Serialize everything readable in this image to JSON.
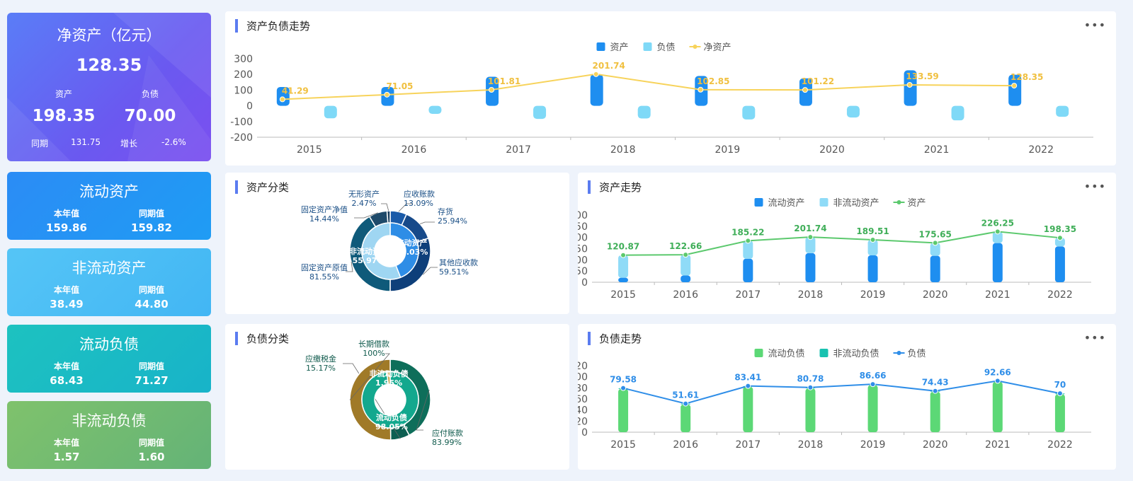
{
  "net_asset_card": {
    "title": "净资产（亿元）",
    "value": "128.35",
    "asset_label": "资产",
    "liability_label": "负债",
    "asset_value": "198.35",
    "liability_value": "70.00",
    "yoy_label": "同期",
    "yoy_value": "131.75",
    "growth_label": "增长",
    "growth_value": "-2.6%"
  },
  "metric_cards": [
    {
      "title": "流动资产",
      "cur_label": "本年值",
      "prev_label": "同期值",
      "cur": "159.86",
      "prev": "159.82"
    },
    {
      "title": "非流动资产",
      "cur_label": "本年值",
      "prev_label": "同期值",
      "cur": "38.49",
      "prev": "44.80"
    },
    {
      "title": "流动负债",
      "cur_label": "本年值",
      "prev_label": "同期值",
      "cur": "68.43",
      "prev": "71.27"
    },
    {
      "title": "非流动负债",
      "cur_label": "本年值",
      "prev_label": "同期值",
      "cur": "1.57",
      "prev": "1.60"
    }
  ],
  "panels": {
    "trend": {
      "title": "资产负债走势",
      "more": "•••"
    },
    "asset_class": {
      "title": "资产分类"
    },
    "asset_trend": {
      "title": "资产走势",
      "more": "•••"
    },
    "liab_class": {
      "title": "负债分类"
    },
    "liab_trend": {
      "title": "负债走势",
      "more": "•••"
    }
  },
  "colors": {
    "asset": "#1e8ef0",
    "liability": "#7fd9f7",
    "net": "#f7d35b",
    "current_asset": "#1e8ef0",
    "noncurrent_asset": "#8fdbf7",
    "asset_line": "#5cc96e",
    "current_liab": "#5cd876",
    "noncurrent_liab": "#19c2b0",
    "liab_line": "#2f8ee8",
    "accent": "#5b7cf0"
  },
  "chart_data": [
    {
      "id": "trend",
      "type": "bar",
      "x": [
        "2015",
        "2016",
        "2017",
        "2018",
        "2019",
        "2020",
        "2021",
        "2022"
      ],
      "ylim": [
        -200,
        300
      ],
      "yticks": [
        300,
        200,
        100,
        0,
        -100,
        -200
      ],
      "series": [
        {
          "name": "资产",
          "type": "bar",
          "values": [
            120,
            120,
            185,
            200,
            190,
            175,
            226,
            198
          ]
        },
        {
          "name": "负债",
          "type": "bar",
          "values": [
            -79.58,
            -51.61,
            -83.41,
            -80.78,
            -86.66,
            -74.43,
            -92.66,
            -70
          ]
        },
        {
          "name": "净资产",
          "type": "line",
          "values": [
            41.29,
            71.05,
            101.81,
            201.74,
            102.85,
            101.22,
            133.59,
            128.35
          ],
          "labels": [
            "41.29",
            "71.05",
            "101.81",
            "201.74",
            "102.85",
            "101.22",
            "133.59",
            "128.35"
          ]
        }
      ]
    },
    {
      "id": "asset_class",
      "type": "pie",
      "inner": [
        {
          "name": "流动资产",
          "value": 44.03,
          "label": "流动资产\n44.03%"
        },
        {
          "name": "非流动资产",
          "value": 55.97,
          "label": "非流动资产\n55.97%"
        }
      ],
      "outer": [
        {
          "name": "应收账款",
          "value": 13.09,
          "label": "13.09%"
        },
        {
          "name": "存货",
          "value": 25.94,
          "label": "25.94%"
        },
        {
          "name": "其他应收款",
          "value": 59.51,
          "label": "59.51%"
        },
        {
          "name": "固定资产原值",
          "value": 81.55,
          "label": "81.55%"
        },
        {
          "name": "固定资产净值",
          "value": 14.44,
          "label": "14.44%"
        },
        {
          "name": "无形资产",
          "value": 2.47,
          "label": "2.47%"
        }
      ]
    },
    {
      "id": "asset_trend",
      "type": "bar",
      "x": [
        "2015",
        "2016",
        "2017",
        "2018",
        "2019",
        "2020",
        "2021",
        "2022"
      ],
      "ylim": [
        0,
        300
      ],
      "yticks": [
        300,
        250,
        200,
        150,
        100,
        50,
        0
      ],
      "series": [
        {
          "name": "流动资产",
          "type": "bar",
          "stack": "a",
          "values": [
            20,
            30,
            105,
            130,
            120,
            118,
            175,
            160
          ]
        },
        {
          "name": "非流动资产",
          "type": "bar",
          "stack": "a",
          "values": [
            100,
            92,
            80,
            71,
            69,
            57,
            50,
            38
          ]
        },
        {
          "name": "资产",
          "type": "line",
          "values": [
            120.87,
            122.66,
            185.22,
            201.74,
            189.51,
            175.65,
            226.25,
            198.35
          ],
          "labels": [
            "120.87",
            "122.66",
            "185.22",
            "201.74",
            "189.51",
            "175.65",
            "226.25",
            "198.35"
          ]
        }
      ]
    },
    {
      "id": "liab_class",
      "type": "pie",
      "inner": [
        {
          "name": "流动负债",
          "value": 98.05,
          "label": "流动负债\n98.05%"
        },
        {
          "name": "非流动负债",
          "value": 1.95,
          "label": "非流动负债\n1.95%"
        }
      ],
      "outer": [
        {
          "name": "应付账款",
          "value": 83.99,
          "label": "83.99%"
        },
        {
          "name": "应缴税金",
          "value": 15.17,
          "label": "15.17%"
        },
        {
          "name": "长期借款",
          "value": 100,
          "label": "100%"
        }
      ]
    },
    {
      "id": "liab_trend",
      "type": "bar",
      "x": [
        "2015",
        "2016",
        "2017",
        "2018",
        "2019",
        "2020",
        "2021",
        "2022"
      ],
      "ylim": [
        0,
        120
      ],
      "yticks": [
        120,
        100,
        80,
        60,
        40,
        20,
        0
      ],
      "series": [
        {
          "name": "流动负债",
          "type": "bar",
          "stack": "l",
          "values": [
            78,
            50,
            82,
            79,
            85,
            73,
            91,
            68.43
          ]
        },
        {
          "name": "非流动负债",
          "type": "bar",
          "stack": "l",
          "values": [
            1.58,
            1.61,
            1.41,
            1.78,
            1.66,
            1.43,
            1.66,
            1.57
          ]
        },
        {
          "name": "负债",
          "type": "line",
          "values": [
            79.58,
            51.61,
            83.41,
            80.78,
            86.66,
            74.43,
            92.66,
            70
          ],
          "labels": [
            "79.58",
            "51.61",
            "83.41",
            "80.78",
            "86.66",
            "74.43",
            "92.66",
            "70"
          ]
        }
      ]
    }
  ]
}
